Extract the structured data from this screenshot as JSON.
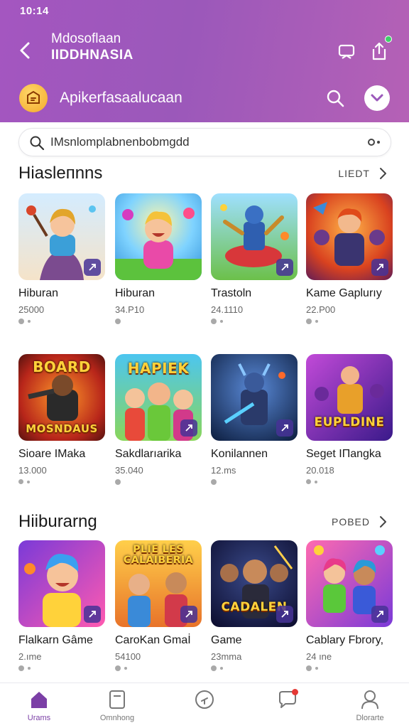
{
  "status_bar": {
    "time": "10:14"
  },
  "header": {
    "title_line1": "Mdosoflaan",
    "title_line2": "IIDDHNASIA",
    "promo_text": "Apikerfasaalucaan",
    "accent": "#a456c0"
  },
  "search": {
    "placeholder": "IMsnlomplabnenbobmgdd"
  },
  "sections": [
    {
      "title": "Hiasleпnns",
      "link": "LIEDT",
      "rows": [
        [
          {
            "name": "Hiburan",
            "meta": "25000"
          },
          {
            "name": "Hiburan",
            "meta": "34.P10"
          },
          {
            "name": "Trastoln",
            "meta": "24.1110"
          },
          {
            "name": "Kame Gaplurıy",
            "meta": "22.P00"
          }
        ],
        [
          {
            "name": "Sioare IMaka",
            "meta": "13.000",
            "banner_top": "BOARD",
            "banner_bottom": "MOSNDAUS"
          },
          {
            "name": "Sakdlarıarika",
            "meta": "35.040",
            "banner_top": "HAPIEK"
          },
          {
            "name": "Konilannen",
            "meta": "12.ms"
          },
          {
            "name": "Seget IПangka",
            "meta": "20.018",
            "banner_bottom": "EUPLDINE"
          }
        ]
      ]
    },
    {
      "title": "Hiiburarng",
      "link": "POBED",
      "rows": [
        [
          {
            "name": "Flalkarn Gâme",
            "meta": "2.ıme"
          },
          {
            "name": "CaroKan Gmaİ",
            "meta": "54100",
            "banner_top": "PLIE LES CALAIBERIA"
          },
          {
            "name": "Game",
            "meta": "23mma",
            "banner_bottom": "CADALEN"
          },
          {
            "name": "Cablary Fbrory,",
            "meta": "24 ıne"
          }
        ]
      ]
    }
  ],
  "bottom_nav": [
    {
      "label": "Urams",
      "icon": "home-icon",
      "active": true
    },
    {
      "label": "Omnhong",
      "icon": "document-icon",
      "active": false
    },
    {
      "label": "",
      "icon": "compass-icon",
      "active": false
    },
    {
      "label": "",
      "icon": "chat-heart-icon",
      "active": false
    },
    {
      "label": "Dlorarte",
      "icon": "profile-icon",
      "active": false
    }
  ]
}
